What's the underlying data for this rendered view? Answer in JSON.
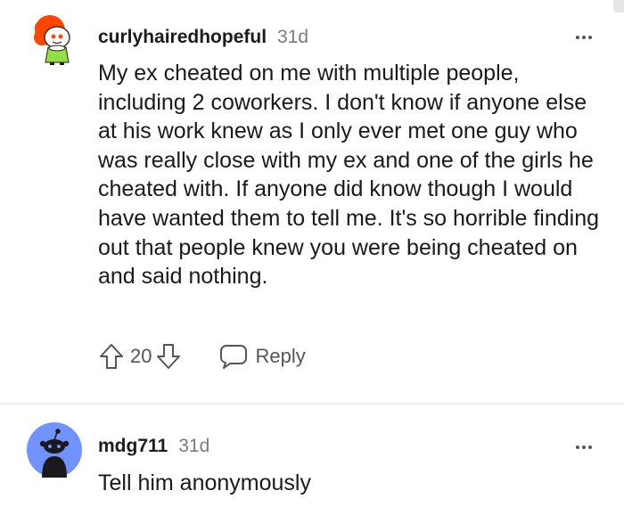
{
  "comments": [
    {
      "username": "curlyhairedhopeful",
      "time": "31d",
      "body": "My ex cheated on me with multiple people, including 2 coworkers. I don't know if anyone else at his work knew as I only ever met one guy who was really close with my ex and one of the girls he cheated with. If anyone did know though I would have wanted them to tell me. It's so horrible finding out that people knew you were being cheated on and said nothing.",
      "score": "20",
      "reply_label": "Reply"
    },
    {
      "username": "mdg711",
      "time": "31d",
      "body": "Tell him anonymously"
    }
  ],
  "icons": {
    "upvote": "arrow-up-icon",
    "downvote": "arrow-down-icon",
    "reply": "speech-bubble-icon",
    "more": "more-horizontal-icon"
  },
  "colors": {
    "avatar_default_bg": "#7193ff",
    "avatar_snoo_hair": "#ff4500",
    "divider": "#edeff1"
  }
}
